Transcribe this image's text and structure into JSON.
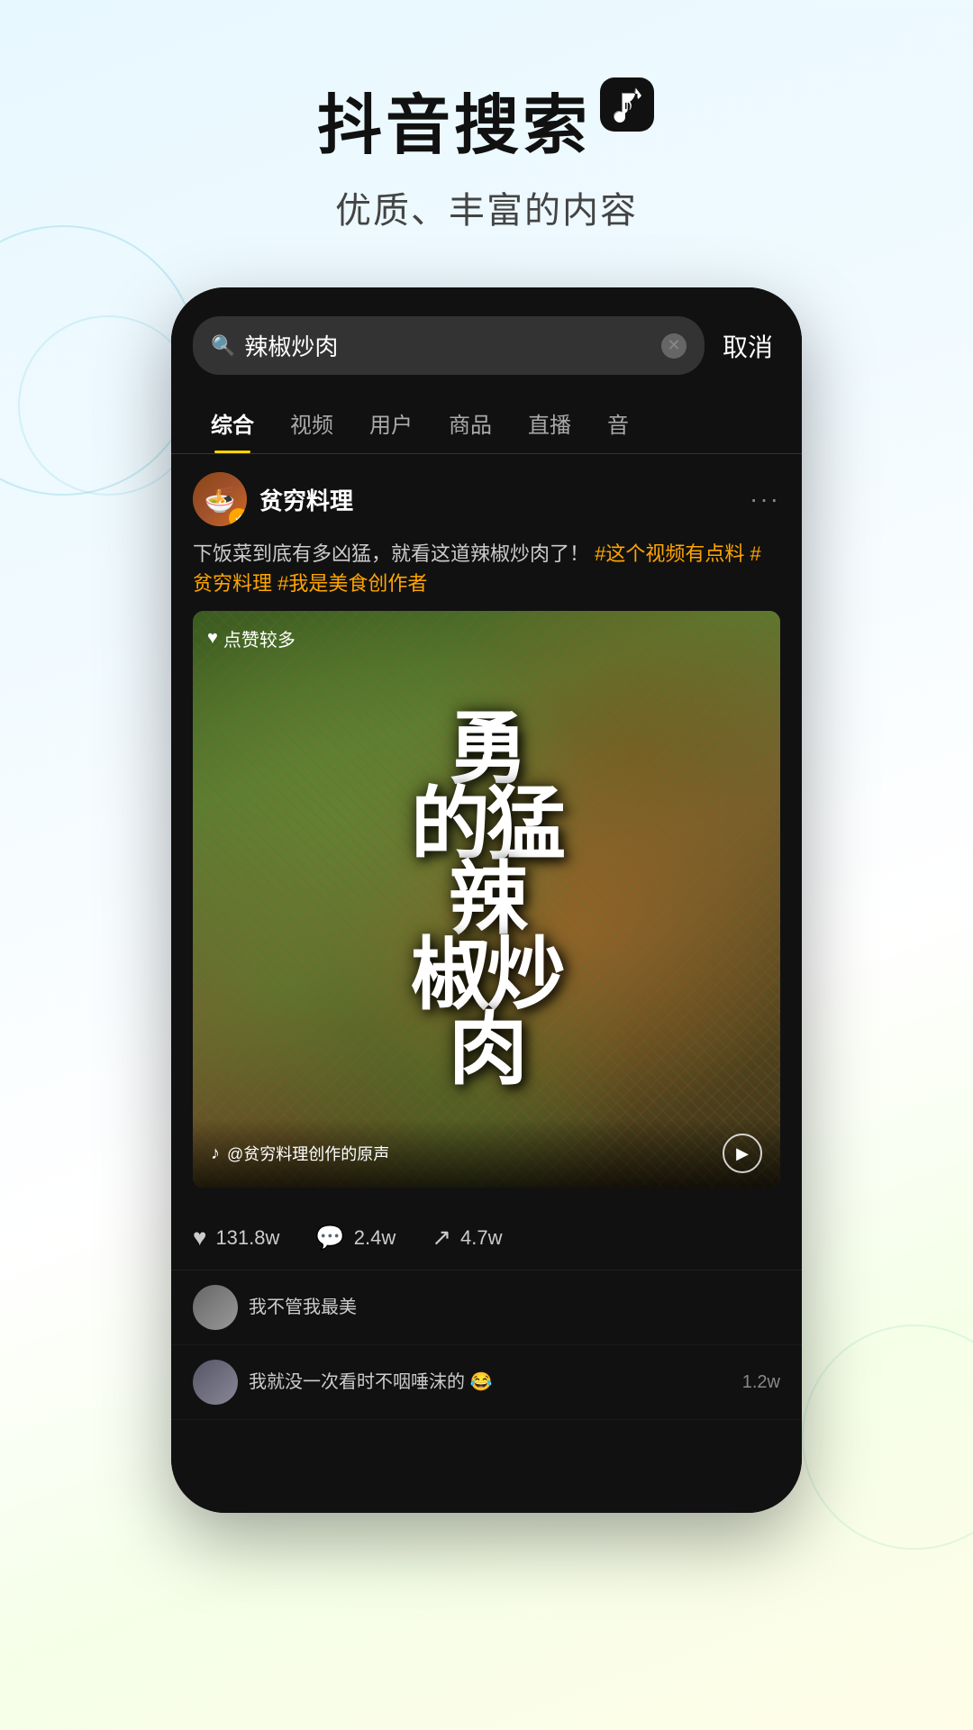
{
  "background": {
    "gradient": "light blue to white to light yellow"
  },
  "header": {
    "title": "抖音搜索",
    "logo_symbol": "♪",
    "subtitle": "优质、丰富的内容"
  },
  "phone": {
    "search_bar": {
      "query": "辣椒炒肉",
      "placeholder": "辣椒炒肉",
      "cancel_label": "取消"
    },
    "tabs": [
      {
        "label": "综合",
        "active": true
      },
      {
        "label": "视频",
        "active": false
      },
      {
        "label": "用户",
        "active": false
      },
      {
        "label": "商品",
        "active": false
      },
      {
        "label": "直播",
        "active": false
      },
      {
        "label": "音",
        "active": false
      }
    ],
    "post": {
      "username": "贫穷料理",
      "verified": true,
      "description": "下饭菜到底有多凶猛，就看这道辣椒炒肉了！",
      "hashtags": [
        "#这个视频有点料",
        "#贫穷料理",
        "#我是美食创作者"
      ],
      "badge_text": "点赞较多",
      "video_title_lines": [
        "勇",
        "的猛",
        "辣",
        "椒炒",
        "肉"
      ],
      "video_title_full": "勇的猛辣椒炒肉",
      "sound_text": "@贫穷料理创作的原声",
      "stats": {
        "likes": "131.8w",
        "comments": "2.4w",
        "shares": "4.7w"
      },
      "comment1": {
        "text": "我不管我最美",
        "count": ""
      },
      "comment2": {
        "text": "我就没一次看时不咽唾沫的 😂",
        "count": "1.2w"
      }
    }
  }
}
